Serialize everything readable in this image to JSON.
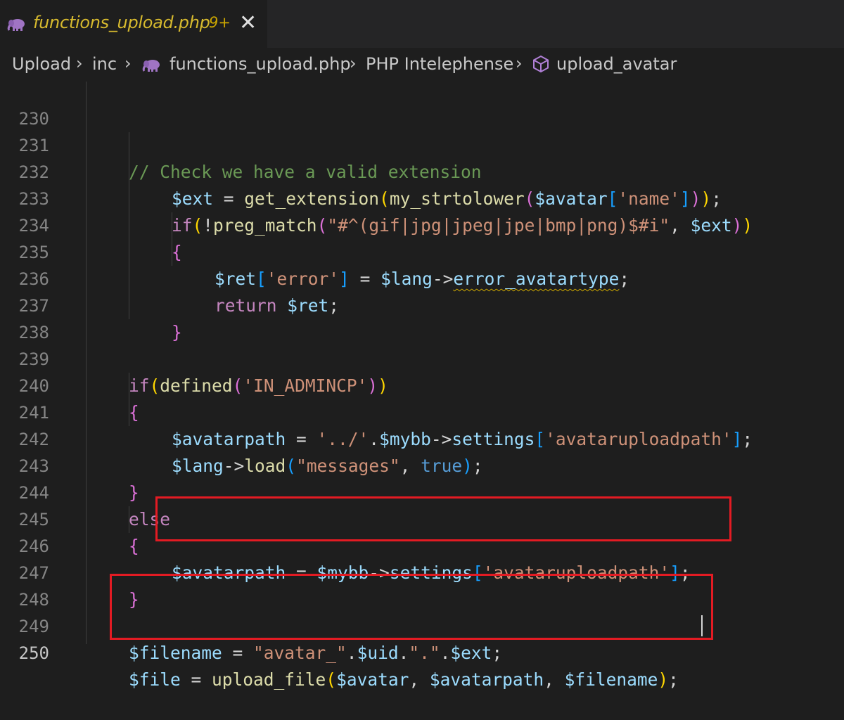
{
  "tab": {
    "filename": "functions_upload.php",
    "badge": "9+",
    "close_glyph": "✕",
    "icon": "php-elephant-icon"
  },
  "breadcrumb": {
    "items": [
      "Upload",
      "inc",
      "functions_upload.php",
      "PHP Intelephense",
      "upload_avatar"
    ],
    "separator": "›"
  },
  "editor": {
    "active_line": 250,
    "line_numbers": [
      "230",
      "231",
      "232",
      "233",
      "234",
      "235",
      "236",
      "237",
      "238",
      "239",
      "240",
      "241",
      "242",
      "243",
      "244",
      "245",
      "246",
      "247",
      "248",
      "249",
      "250"
    ],
    "lines": [
      "",
      "// Check we have a valid extension",
      "$ext = get_extension(my_strtolower($avatar['name']));",
      "if(!preg_match(\"#^(gif|jpg|jpeg|jpe|bmp|png)$#i\", $ext))",
      "{",
      "$ret['error'] = $lang->error_avatartype;",
      "return $ret;",
      "}",
      "",
      "if(defined('IN_ADMINCP'))",
      "{",
      "$avatarpath = '../'.$mybb->settings['avataruploadpath'];",
      "$lang->load(\"messages\", true);",
      "}",
      "else",
      "{",
      "$avatarpath = $mybb->settings['avataruploadpath'];",
      "}",
      "",
      "$filename = \"avatar_\".$uid.\".\".$ext;",
      "$file = upload_file($avatar, $avatarpath, $filename);"
    ]
  },
  "colors": {
    "background": "#1e1e1e",
    "highlight_box": "#e31b23",
    "comment": "#6a9955",
    "variable": "#9cdcfe",
    "function": "#dcdcaa",
    "string": "#ce9178",
    "keyword": "#c586c0"
  }
}
